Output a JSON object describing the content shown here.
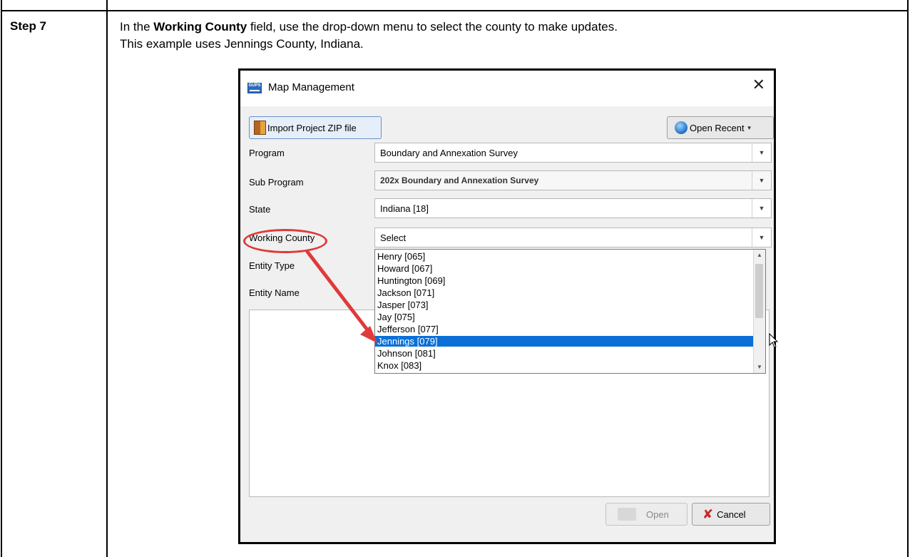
{
  "step": {
    "label": "Step 7",
    "instruction_pre": "In the ",
    "instruction_bold": "Working County",
    "instruction_post": " field, use the drop-down menu to select the county to make updates.",
    "instruction_line2": "This example uses Jennings County, Indiana."
  },
  "dialog": {
    "title": "Map Management",
    "app_icon_text": "GUPS",
    "import_button": "Import Project ZIP file",
    "open_recent_button": "Open Recent",
    "fields": {
      "program": {
        "label": "Program",
        "value": "Boundary and Annexation Survey"
      },
      "sub_program": {
        "label": "Sub Program",
        "value": "202x Boundary and Annexation Survey"
      },
      "state": {
        "label": "State",
        "value": "Indiana [18]"
      },
      "working_county": {
        "label": "Working County",
        "value": "Select"
      },
      "entity_type": {
        "label": "Entity Type"
      },
      "entity_name": {
        "label": "Entity Name"
      }
    },
    "county_options": [
      "Henry [065]",
      "Howard [067]",
      "Huntington [069]",
      "Jackson [071]",
      "Jasper [073]",
      "Jay [075]",
      "Jefferson [077]",
      "Jennings [079]",
      "Johnson [081]",
      "Knox [083]"
    ],
    "selected_county": "Jennings [079]",
    "open_button": "Open",
    "cancel_button": "Cancel"
  },
  "colors": {
    "selection": "#0a6fd6",
    "annotation": "#e03a3a"
  },
  "icons": [
    "import-zip-icon",
    "open-recent-icon",
    "close-icon",
    "folder-icon",
    "cancel-x-icon",
    "dropdown-arrow-icon",
    "mouse-cursor-icon"
  ]
}
